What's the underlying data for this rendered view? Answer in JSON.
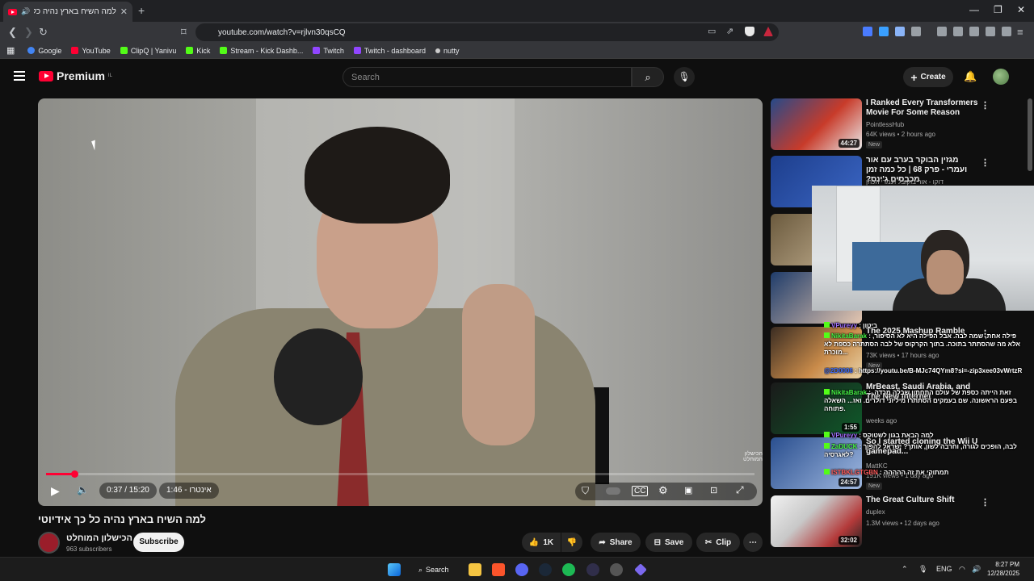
{
  "browser": {
    "tab_title": "למה השיח בארץ נהיה כל כך אידיוטי",
    "url": "youtube.com/watch?v=rjlvn30qsCQ",
    "bookmarks": [
      {
        "label": "Google",
        "color": "#4285f4"
      },
      {
        "label": "YouTube",
        "color": "#ff0033"
      },
      {
        "label": "ClipQ | Yanivu",
        "color": "#53fc18"
      },
      {
        "label": "Kick",
        "color": "#53fc18"
      },
      {
        "label": "Stream - Kick Dashb...",
        "color": "#53fc18"
      },
      {
        "label": "Twitch",
        "color": "#9146ff"
      },
      {
        "label": "Twitch - dashboard",
        "color": "#9146ff"
      },
      {
        "label": "nutty",
        "color": "#cccccc"
      }
    ]
  },
  "header": {
    "logo_text": "Premium",
    "logo_region": "IL",
    "search_placeholder": "Search",
    "create_label": "Create"
  },
  "player": {
    "time": "0:37 / 15:20",
    "chapter": "1:46 - אינטרו",
    "progress": 0.04,
    "watermark": "הכישלון המוחלט"
  },
  "video": {
    "title": "למה השיח בארץ נהיה כל כך אידיוטי",
    "channel": "הכישלון המוחלט",
    "subscribers": "963 subscribers",
    "subscribe_label": "Subscribe",
    "like_count": "1K",
    "share_label": "Share",
    "save_label": "Save",
    "clip_label": "Clip"
  },
  "recommendations": [
    {
      "title": "I Ranked Every Transformers Movie For Some Reason",
      "channel": "PointlessHub",
      "meta": "64K views • 2 hours ago",
      "duration": "44:27",
      "badge": "New"
    },
    {
      "title": "מגזין הבוקר בערב עם אור ועמרי - פרק 68 | כל כמה זמן מכבסים ג'ינס?",
      "channel": "דוקו - אור בוקובל ועמרי הכהן",
      "meta": "",
      "duration": "",
      "badge": ""
    },
    {
      "title": "The 2025 Mashup Ramble",
      "channel": "",
      "meta": "73K views • 17 hours ago",
      "duration": "",
      "badge": "New"
    },
    {
      "title": "MrBeast, Saudi Arabia, and The New Internet",
      "channel": "",
      "meta": "weeks ago",
      "duration": "1:55",
      "badge": ""
    },
    {
      "title": "So I started cloning the Wii U gamepad...",
      "channel": "MattKC",
      "meta": "191K views • 1 day ago",
      "duration": "24:57",
      "badge": "New"
    },
    {
      "title": "The Great Culture Shift",
      "channel": "duplex",
      "meta": "1.3M views • 12 days ago",
      "duration": "32:02",
      "badge": ""
    }
  ],
  "chat": [
    {
      "user": "VPureyy",
      "text": ": ביטון"
    },
    {
      "user": "NikitaBarak",
      "text": ": פילה אחת, שמה לבה. אבל הפילה היא לא הסיפור, אלא מה שהסתתר בתוכה. בתוך הקרקוס של לבה הסתתרה כספת לא מוכרת..."
    },
    {
      "user": "@2D0006",
      "text": ": https://youtu.be/B-MJc74QYm8?si=-zip3xee03vWrtzR"
    },
    {
      "user": "NikitaBarak",
      "text": ": זאת הייתה כספת של עולם התחתון שבלה מרדה. בפעם הראשונה. שם בעמקים הסתתרו מיליוני דולרים. ואז... השאלה פתוחה."
    },
    {
      "user": "VPureyy",
      "text": ": למה הבאת בגון לשטוקס"
    },
    {
      "user": "ZaDUCK",
      "text": ": לבה, הופכים לגורה, וחרבה לשון, אותך? ישראל להפוך לאגרסיה?"
    },
    {
      "user": "ISTBKLGTGBN",
      "text": ": תמתוקי את זה ההההה"
    }
  ],
  "taskbar": {
    "search_label": "Search",
    "lang": "ENG",
    "time": "8:27 PM",
    "date": "12/28/2025"
  }
}
